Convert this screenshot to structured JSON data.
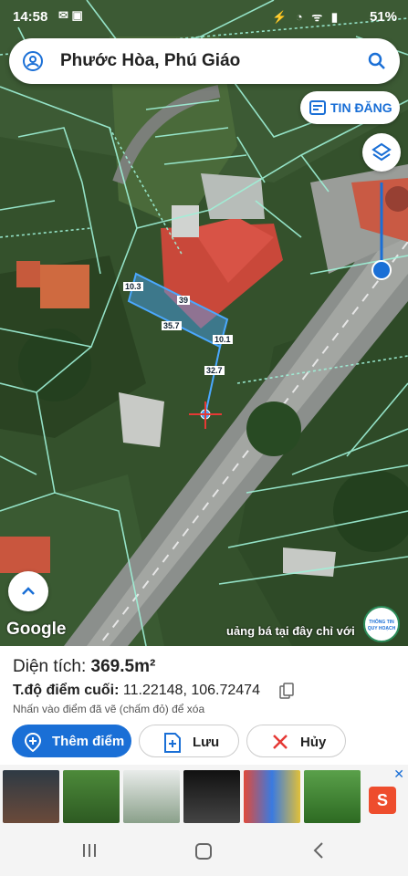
{
  "status_bar": {
    "time": "14:58",
    "battery": "51%"
  },
  "search": {
    "location": "Phước Hòa, Phú Giáo"
  },
  "tin_dang": {
    "label": "TIN ĐĂNG"
  },
  "map": {
    "segment_labels": [
      "10.3",
      "39",
      "35.7",
      "10.1",
      "32.7"
    ],
    "google_label": "Google",
    "ad_overlay_text": "uảng bá tại đây chỉ với",
    "planning_badge": {
      "line1": "THÔNG TIN",
      "line2": "QUY HOẠCH"
    }
  },
  "info": {
    "area_label": "Diện tích:",
    "area_value": "369.5m²",
    "coord_label": "T.độ điểm cuối:",
    "coord_value": "11.22148, 106.72474",
    "hint": "Nhấn vào điểm đã vẽ (chấm đỏ) để xóa"
  },
  "buttons": {
    "add_point": "Thêm điểm",
    "save": "Lưu",
    "cancel": "Hủy"
  },
  "ad": {
    "close": "✕",
    "brand_initial": "S"
  },
  "colors": {
    "accent": "#1a6fd6",
    "parcel": "#4aa8ff",
    "lines": "#9ff2d8"
  }
}
